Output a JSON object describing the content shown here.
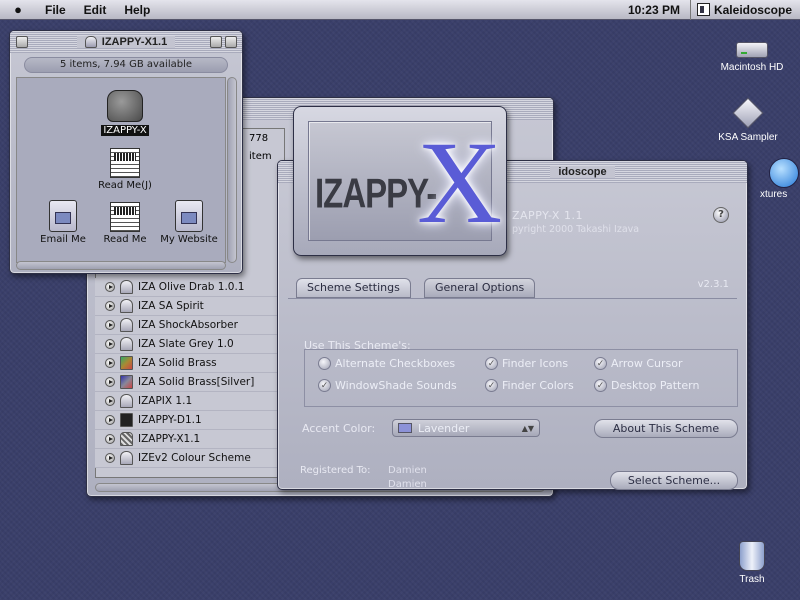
{
  "menubar": {
    "apple": "",
    "items": [
      "File",
      "Edit",
      "Help"
    ],
    "clock": "10:23 PM",
    "active_app": "Kaleidoscope"
  },
  "finder_window": {
    "title": "IZAPPY-X1.1",
    "info": "5 items, 7.94 GB available",
    "icons": [
      {
        "label": "IZAPPY-X",
        "type": "drive",
        "selected": true
      },
      {
        "label": "Read Me(J)",
        "type": "document"
      },
      {
        "label": "Email Me",
        "type": "html"
      },
      {
        "label": "Read Me",
        "type": "document"
      },
      {
        "label": "My Website",
        "type": "html"
      }
    ]
  },
  "list_window": {
    "count": "778 item",
    "rows": [
      {
        "name": "IZA Olive Drab 1.0.1",
        "icon": "scheme"
      },
      {
        "name": "IZA SA Spirit",
        "icon": "scheme"
      },
      {
        "name": "IZA ShockAbsorber",
        "icon": "scheme"
      },
      {
        "name": "IZA Slate Grey 1.0",
        "icon": "scheme"
      },
      {
        "name": "IZA Solid Brass",
        "icon": "brass"
      },
      {
        "name": "IZA Solid Brass[Silver]",
        "icon": "silver"
      },
      {
        "name": "IZAPIX 1.1",
        "icon": "scheme"
      },
      {
        "name": "IZAPPY-D1.1",
        "icon": "folder"
      },
      {
        "name": "IZAPPY-X1.1",
        "icon": "pattern"
      },
      {
        "name": "IZEv2 Colour Scheme",
        "icon": "scheme"
      }
    ]
  },
  "kaleidoscope": {
    "title": "idoscope",
    "scheme_name": "ZAPPY-X 1.1",
    "copyright": "pyright 2000 Takashi Izava",
    "version": "v2.3.1",
    "help": "?",
    "tabs": [
      "Scheme Settings",
      "General Options"
    ],
    "use_label": "Use This Scheme's:",
    "options": [
      "Alternate Checkboxes",
      "Finder Icons",
      "Arrow Cursor",
      "WindowShade Sounds",
      "Finder Colors",
      "Desktop Pattern"
    ],
    "accent_label": "Accent Color:",
    "accent_value": "Lavender",
    "accent_color": "#8c92d8",
    "about_button": "About This Scheme",
    "registered_label": "Registered To:",
    "registered_names": [
      "Damien",
      "Damien"
    ],
    "select_button": "Select Scheme..."
  },
  "logo": {
    "text": "IZAPPY-",
    "x": "X"
  },
  "desktop": {
    "icons": [
      {
        "label": "Macintosh HD"
      },
      {
        "label": "KSA Sampler"
      },
      {
        "label": "xtures"
      },
      {
        "label": "Trash"
      }
    ]
  }
}
